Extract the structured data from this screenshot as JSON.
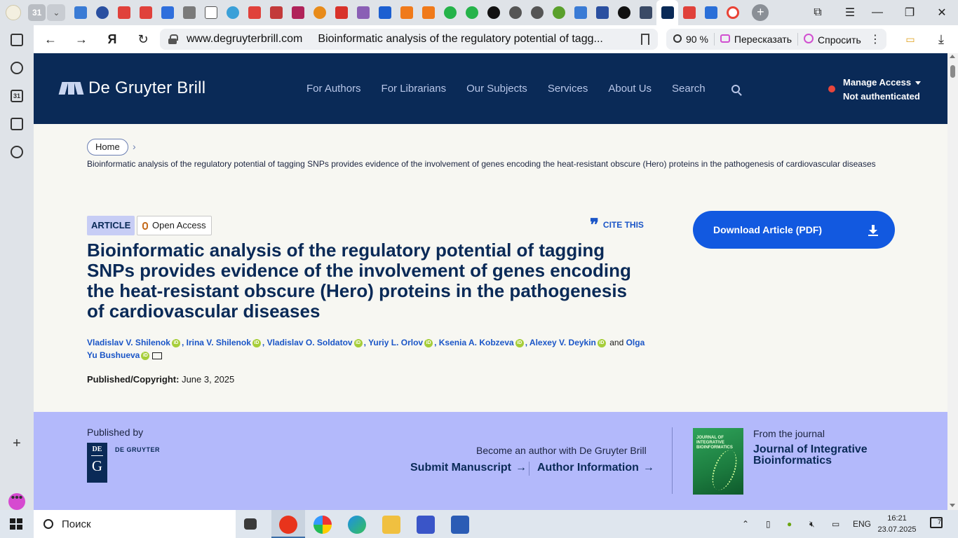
{
  "browser": {
    "calendar_tab_label": "31",
    "url_domain": "www.degruyterbrill.com",
    "url_title": "Bioinformatic analysis of the regulatory potential of tagg...",
    "zoom": "90 %",
    "retell_label": "Пересказать",
    "ask_label": "Спросить",
    "sidebar_calendar_label": "31"
  },
  "site": {
    "logo_text": "De Gruyter Brill",
    "nav": [
      "For Authors",
      "For Librarians",
      "Our Subjects",
      "Services",
      "About Us",
      "Search"
    ],
    "access_label": "Manage Access",
    "access_status": "Not authenticated"
  },
  "breadcrumb": {
    "home": "Home",
    "current": "Bioinformatic analysis of the regulatory potential of tagging SNPs provides evidence of the involvement of genes encoding the heat-resistant obscure (Hero) proteins in the pathogenesis of cardiovascular diseases"
  },
  "article": {
    "type_badge": "ARTICLE",
    "access_badge": "Open Access",
    "cite_label": "CITE THIS",
    "title": "Bioinformatic analysis of the regulatory potential of tagging SNPs provides evidence of the involvement of genes encoding the heat-resistant obscure (Hero) proteins in the pathogenesis of cardiovascular diseases",
    "authors": [
      "Vladislav V. Shilenok",
      "Irina V. Shilenok",
      "Vladislav O. Soldatov",
      "Yuriy L. Orlov",
      "Ksenia A. Kobzeva",
      "Alexey V. Deykin",
      "Olga Yu Bushueva"
    ],
    "and_word": "and",
    "orcid_label": "iD",
    "published_label": "Published/Copyright:",
    "published_date": "June 3, 2025",
    "download_label": "Download Article (PDF)"
  },
  "publisher": {
    "published_by": "Published by",
    "logo_de": "DE",
    "logo_g": "G",
    "logo_name": "DE GRUYTER",
    "become_author": "Become an author with De Gruyter Brill",
    "submit_label": "Submit Manuscript",
    "author_info_label": "Author Information",
    "arrow": "→",
    "cover_text": "JOURNAL OF INTEGRATIVE BIOINFORMATICS",
    "from_journal": "From the journal",
    "journal_name": "Journal of Integrative Bioinformatics"
  },
  "taskbar": {
    "search_placeholder": "Поиск",
    "language": "ENG",
    "time": "16:21",
    "date": "23.07.2025",
    "notifications": "7"
  },
  "colors": {
    "header_bg": "#0a2a57",
    "link_blue": "#1a55c7",
    "download_blue": "#1259e0",
    "band_bg": "#b3b9fb",
    "status_red": "#e8463c",
    "orcid_green": "#a6ce39"
  }
}
